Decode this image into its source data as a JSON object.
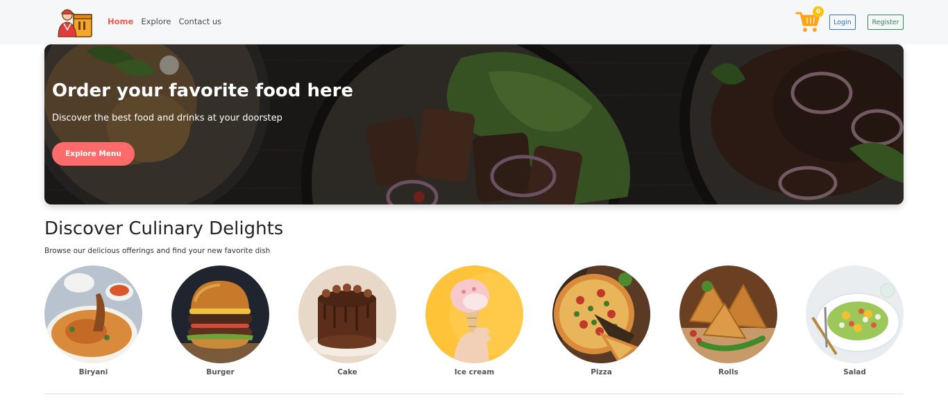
{
  "nav": {
    "links": [
      "Home",
      "Explore",
      "Contact us"
    ],
    "cart_count": "0",
    "login_label": "Login",
    "register_label": "Register"
  },
  "hero": {
    "title": "Order your favorite food here",
    "subtitle": "Discover the best food and drinks at your doorstep",
    "button_label": "Explore Menu"
  },
  "section": {
    "title": "Discover Culinary Delights",
    "subtitle": "Browse our delicious offerings and find your new favorite dish"
  },
  "categories": [
    {
      "label": "Biryani"
    },
    {
      "label": "Burger"
    },
    {
      "label": "Cake"
    },
    {
      "label": "Ice cream"
    },
    {
      "label": "Pizza"
    },
    {
      "label": "Rolls"
    },
    {
      "label": "Salad"
    }
  ],
  "colors": {
    "accent": "#ff6b6b",
    "active_nav": "#f05a4a",
    "cart": "#ffa31a",
    "badge": "#ffc10c",
    "login": "#2f6fd6",
    "register": "#2f8a52"
  },
  "icons": {
    "logo": "delivery-person-logo",
    "cart": "shopping-cart-icon"
  }
}
